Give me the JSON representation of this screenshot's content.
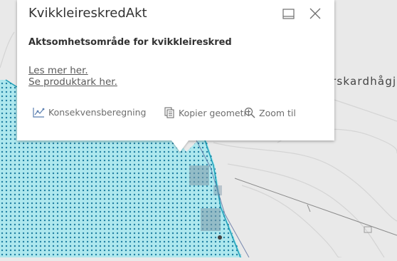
{
  "popup": {
    "title": "KvikkleireskredAkt",
    "heading": "Aktsomhetsområde for kvikkleireskred",
    "links": [
      "Les mer her.",
      "Se produktark her."
    ],
    "actions": [
      {
        "label": "Konsekvensberegning",
        "icon": "chart-line-icon"
      },
      {
        "label": "Kopier geometri",
        "icon": "copy-document-icon"
      },
      {
        "label": "Zoom til",
        "icon": "zoom-in-icon"
      }
    ],
    "controls": {
      "dock": "dock-icon",
      "close": "close-icon"
    }
  },
  "map": {
    "place_label": "rskardhågj",
    "colors": {
      "hazard_fill": "#aee8ee",
      "hazard_border": "#1f9fb8",
      "base": "#e9e9e9"
    }
  }
}
